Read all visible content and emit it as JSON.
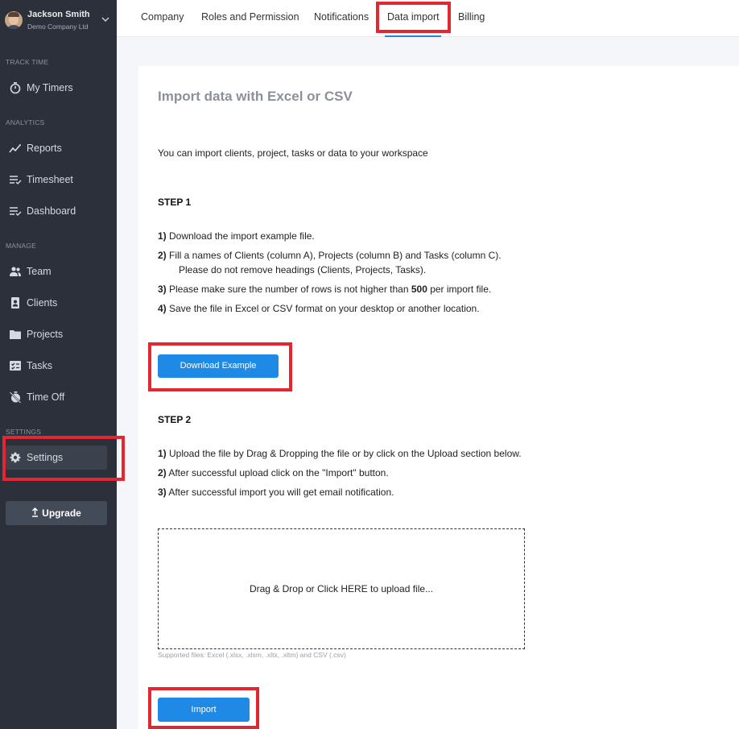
{
  "user": {
    "name": "Jackson Smith",
    "company": "Demo Company Ltd"
  },
  "sidebar": {
    "sections": {
      "track_time": "TRACK TIME",
      "analytics": "ANALYTICS",
      "manage": "MANAGE",
      "settings": "SETTINGS"
    },
    "items": [
      {
        "label": "My Timers",
        "icon": "stopwatch-icon"
      },
      {
        "label": "Reports",
        "icon": "trend-line-icon"
      },
      {
        "label": "Timesheet",
        "icon": "list-check-icon"
      },
      {
        "label": "Dashboard",
        "icon": "list-check-icon"
      },
      {
        "label": "Team",
        "icon": "people-icon"
      },
      {
        "label": "Clients",
        "icon": "contact-card-icon"
      },
      {
        "label": "Projects",
        "icon": "folder-icon"
      },
      {
        "label": "Tasks",
        "icon": "tasks-icon"
      },
      {
        "label": "Time Off",
        "icon": "timer-off-icon"
      },
      {
        "label": "Settings",
        "icon": "gear-icon",
        "active": true
      }
    ],
    "upgrade_label": "Upgrade"
  },
  "tabs": [
    {
      "label": "Company"
    },
    {
      "label": "Roles and Permission"
    },
    {
      "label": "Notifications"
    },
    {
      "label": "Data import",
      "active": true
    },
    {
      "label": "Billing"
    }
  ],
  "main": {
    "title": "Import data with Excel or CSV",
    "intro": "You can import clients, project, tasks or data to your workspace",
    "step1": {
      "heading": "STEP 1",
      "lines": [
        {
          "num": "1)",
          "text": " Download the import example file."
        },
        {
          "num": "2)",
          "text": " Fill a names of Clients (column A), Projects (column B) and Tasks (column C)."
        },
        {
          "text": "Please do not remove headings (Clients, Projects, Tasks)."
        },
        {
          "num": "3)",
          "text_before": " Please make sure the number of rows is not higher than ",
          "bold": "500",
          "text_after": " per import file."
        },
        {
          "num": "4)",
          "text": " Save the file in Excel or CSV format on your desktop or another location."
        }
      ],
      "download_button": "Download Example"
    },
    "step2": {
      "heading": "STEP 2",
      "lines": [
        {
          "num": "1)",
          "text": " Upload the file by Drag & Dropping the file or by click on the Upload section below."
        },
        {
          "num": "2)",
          "text": " After successful upload click on the \"Import\" button."
        },
        {
          "num": "3)",
          "text": " After successful import you will get email notification."
        }
      ]
    },
    "dropzone_text": "Drag & Drop or Click HERE to upload file...",
    "supported_files": "Supported files: Excel (.xlsx, .xlsm, .xltx, .xltm) and CSV (.csv)",
    "import_button": "Import"
  },
  "colors": {
    "sidebar_bg": "#2b303b",
    "accent": "#1f8ae6",
    "highlight": "#e3262f"
  }
}
